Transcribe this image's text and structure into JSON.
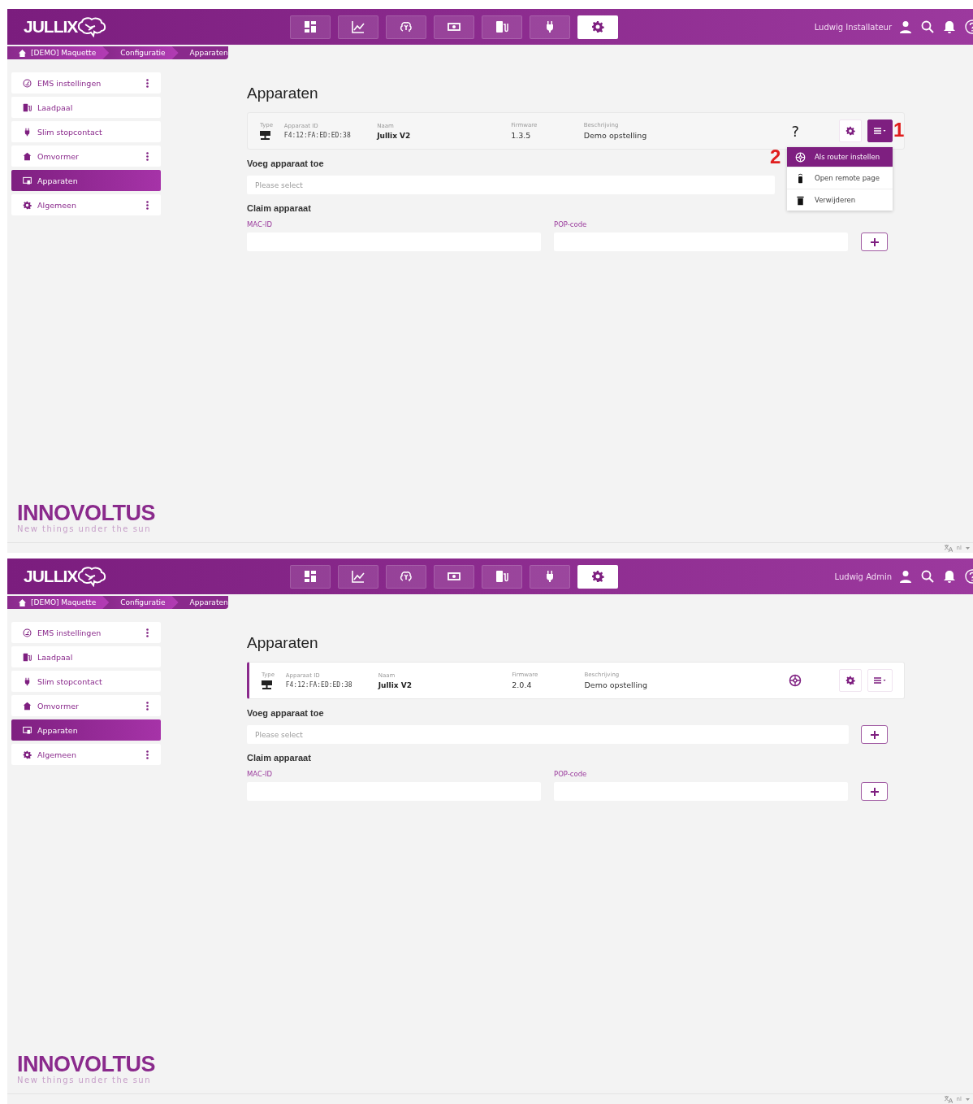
{
  "screens": [
    {
      "logo": "JULLIX",
      "user": "Ludwig Installateur",
      "nav": [
        {
          "selected": false
        },
        {
          "selected": false
        },
        {
          "selected": false
        },
        {
          "selected": false
        },
        {
          "selected": false
        },
        {
          "selected": false
        },
        {
          "selected": true
        }
      ],
      "breadcrumb": [
        "[DEMO] Maquette",
        "Configuratie",
        "Apparaten"
      ],
      "sidebar": [
        {
          "label": "EMS instellingen",
          "has_menu": true,
          "selected": false
        },
        {
          "label": "Laadpaal",
          "has_menu": false,
          "selected": false
        },
        {
          "label": "Slim stopcontact",
          "has_menu": false,
          "selected": false
        },
        {
          "label": "Omvormer",
          "has_menu": true,
          "selected": false
        },
        {
          "label": "Apparaten",
          "has_menu": false,
          "selected": true
        },
        {
          "label": "Algemeen",
          "has_menu": true,
          "selected": false
        }
      ],
      "title": "Apparaten",
      "device": {
        "columns": [
          "Type",
          "Apparaat ID",
          "Naam",
          "Firmware",
          "Beschrijving"
        ],
        "id": "F4:12:FA:ED:ED:38",
        "name": "Jullix V2",
        "firmware": "1.3.5",
        "description": "Demo opstelling",
        "status": {
          "kind": "unknown",
          "text": "?"
        },
        "highlighted": false,
        "menu_open": true
      },
      "menu": [
        {
          "label": "Als router instellen",
          "selected": true
        },
        {
          "label": "Open remote page",
          "selected": false
        },
        {
          "label": "Verwijderen",
          "selected": false
        }
      ],
      "markers": {
        "menu_button": "1",
        "menu_item": "2"
      },
      "add": {
        "heading": "Voeg apparaat toe",
        "placeholder": "Please select"
      },
      "claim": {
        "heading": "Claim apparaat",
        "fields": [
          {
            "label": "MAC-ID"
          },
          {
            "label": "POP-code"
          }
        ]
      },
      "footer": {
        "brand": "INNOVOLTUS",
        "tagline": "New things under the sun",
        "language": "nl"
      }
    },
    {
      "logo": "JULLIX",
      "user": "Ludwig Admin",
      "nav": [
        {
          "selected": false
        },
        {
          "selected": false
        },
        {
          "selected": false
        },
        {
          "selected": false
        },
        {
          "selected": false
        },
        {
          "selected": false
        },
        {
          "selected": true
        }
      ],
      "breadcrumb": [
        "[DEMO] Maquette",
        "Configuratie",
        "Apparaten"
      ],
      "sidebar": [
        {
          "label": "EMS instellingen",
          "has_menu": true,
          "selected": false
        },
        {
          "label": "Laadpaal",
          "has_menu": false,
          "selected": false
        },
        {
          "label": "Slim stopcontact",
          "has_menu": false,
          "selected": false
        },
        {
          "label": "Omvormer",
          "has_menu": true,
          "selected": false
        },
        {
          "label": "Apparaten",
          "has_menu": false,
          "selected": true
        },
        {
          "label": "Algemeen",
          "has_menu": true,
          "selected": false
        }
      ],
      "title": "Apparaten",
      "device": {
        "columns": [
          "Type",
          "Apparaat ID",
          "Naam",
          "Firmware",
          "Beschrijving"
        ],
        "id": "F4:12:FA:ED:ED:38",
        "name": "Jullix V2",
        "firmware": "2.0.4",
        "description": "Demo opstelling",
        "status": {
          "kind": "router"
        },
        "highlighted": true,
        "menu_open": false
      },
      "add": {
        "heading": "Voeg apparaat toe",
        "placeholder": "Please select"
      },
      "claim": {
        "heading": "Claim apparaat",
        "fields": [
          {
            "label": "MAC-ID"
          },
          {
            "label": "POP-code"
          }
        ]
      },
      "footer": {
        "brand": "INNOVOLTUS",
        "tagline": "New things under the sun",
        "language": "nl"
      }
    }
  ]
}
